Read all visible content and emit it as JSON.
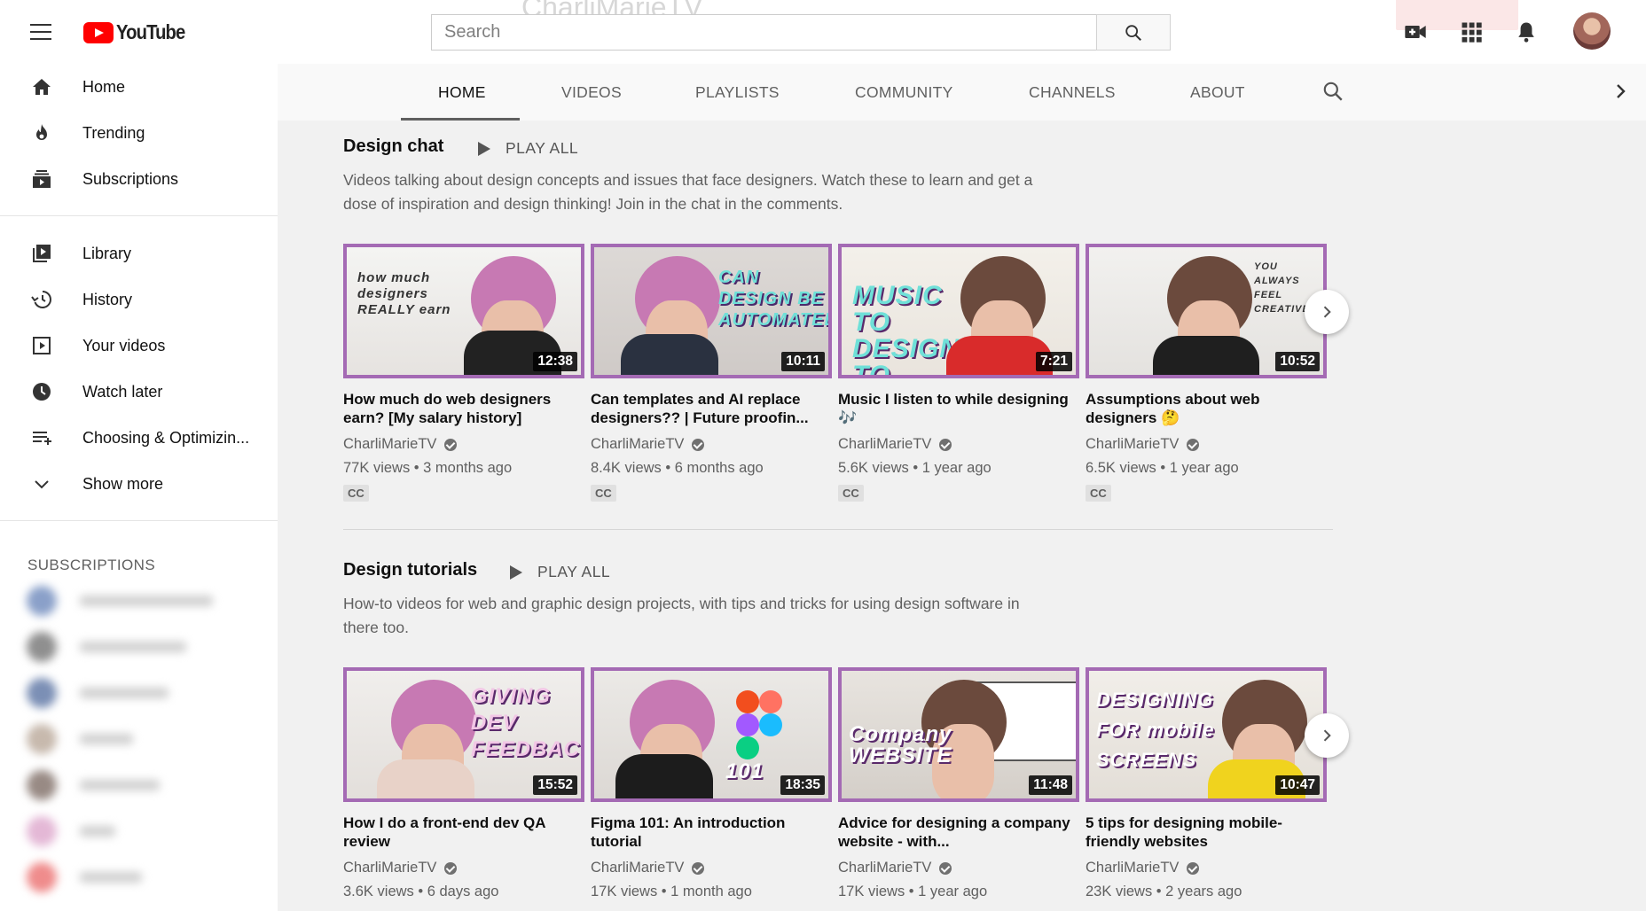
{
  "header": {
    "logo_text": "YouTube",
    "search_placeholder": "Search",
    "channel_name_bg": "CharliMarieTV"
  },
  "sidebar": {
    "primary": [
      {
        "label": "Home",
        "icon": "home-icon"
      },
      {
        "label": "Trending",
        "icon": "trending-icon"
      },
      {
        "label": "Subscriptions",
        "icon": "subscriptions-icon"
      }
    ],
    "secondary": [
      {
        "label": "Library",
        "icon": "library-icon"
      },
      {
        "label": "History",
        "icon": "history-icon"
      },
      {
        "label": "Your videos",
        "icon": "your-videos-icon"
      },
      {
        "label": "Watch later",
        "icon": "watch-later-icon"
      },
      {
        "label": "Choosing & Optimizin...",
        "icon": "playlist-icon"
      },
      {
        "label": "Show more",
        "icon": "chevron-down-icon"
      }
    ],
    "subscriptions_title": "SUBSCRIPTIONS"
  },
  "tabs": {
    "items": [
      "HOME",
      "VIDEOS",
      "PLAYLISTS",
      "COMMUNITY",
      "CHANNELS",
      "ABOUT"
    ],
    "active": "HOME"
  },
  "sections": [
    {
      "title": "Design chat",
      "play_all": "PLAY ALL",
      "description": "Videos talking about design concepts and issues that face designers. Watch these to learn and get a dose of inspiration and design thinking! Join in the chat in the comments.",
      "videos": [
        {
          "title": "How much do web designers earn? [My salary history]",
          "channel": "CharliMarieTV",
          "meta": "77K views • 3 months ago",
          "duration": "12:38",
          "cc": "CC",
          "thumb_text": "how much designers REALLY earn"
        },
        {
          "title": "Can templates and AI replace designers?? | Future proofin...",
          "channel": "CharliMarieTV",
          "meta": "8.4K views • 6 months ago",
          "duration": "10:11",
          "cc": "CC",
          "thumb_text": "CAN DESIGN BE AUTOMATED?"
        },
        {
          "title": "Music I listen to while designing 🎶",
          "channel": "CharliMarieTV",
          "meta": "5.6K views • 1 year ago",
          "duration": "7:21",
          "cc": "CC",
          "thumb_text": "MUSIC TO DESIGN TO"
        },
        {
          "title": "Assumptions about web designers 🤔",
          "channel": "CharliMarieTV",
          "meta": "6.5K views • 1 year ago",
          "duration": "10:52",
          "cc": "CC",
          "thumb_text": "YOU ALWAYS FEEL CREATIVE"
        }
      ]
    },
    {
      "title": "Design tutorials",
      "play_all": "PLAY ALL",
      "description": "How-to videos for web and graphic design projects, with tips and tricks for using design software in there too.",
      "videos": [
        {
          "title": "How I do a front-end dev QA review",
          "channel": "CharliMarieTV",
          "meta": "3.6K views • 6 days ago",
          "duration": "15:52",
          "thumb_text": "GIVING DEV FEEDBACK"
        },
        {
          "title": "Figma 101: An introduction tutorial",
          "channel": "CharliMarieTV",
          "meta": "17K views • 1 month ago",
          "duration": "18:35",
          "thumb_text": "101"
        },
        {
          "title": "Advice for designing a company website - with...",
          "channel": "CharliMarieTV",
          "meta": "17K views • 1 year ago",
          "duration": "11:48",
          "thumb_text": "Company WEBSITE"
        },
        {
          "title": "5 tips for designing mobile-friendly websites",
          "channel": "CharliMarieTV",
          "meta": "23K views • 2 years ago",
          "duration": "10:47",
          "thumb_text": "DESIGNING FOR mobile SCREENS"
        }
      ]
    }
  ],
  "colors": {
    "accent_red": "#ff0000",
    "thumb_border": "#a46ab4"
  }
}
